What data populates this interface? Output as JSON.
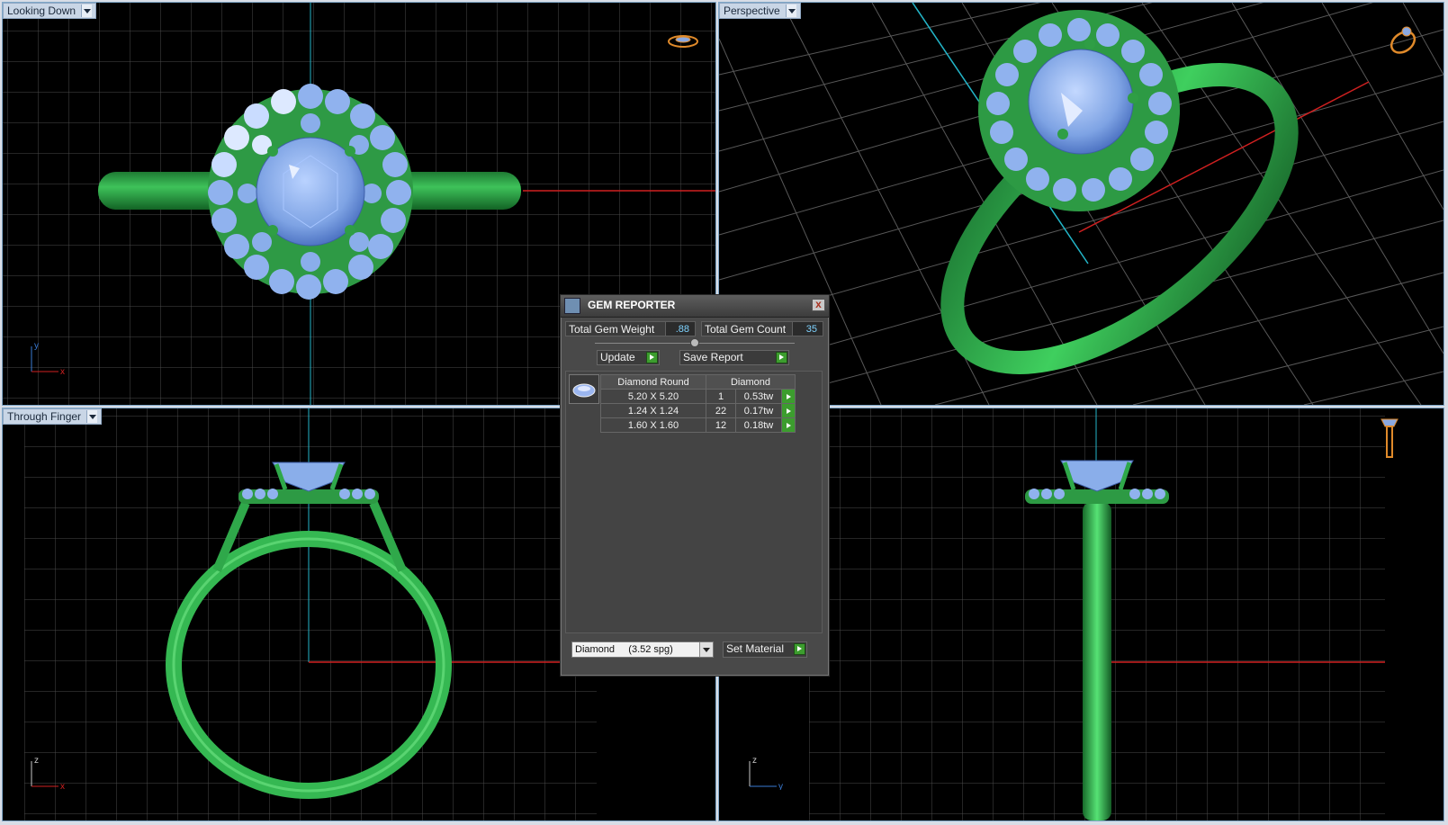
{
  "viewports": {
    "top_left": {
      "label": "Looking Down",
      "axes": [
        "y",
        "x"
      ]
    },
    "top_right": {
      "label": "Perspective"
    },
    "bottom_left": {
      "label": "Through Finger",
      "axes": [
        "z",
        "x"
      ]
    },
    "bottom_right": {
      "axes": [
        "z",
        "y"
      ]
    }
  },
  "gem_reporter": {
    "title": "GEM REPORTER",
    "close_label": "x",
    "total_gem_weight_label": "Total Gem Weight",
    "total_gem_weight_value": ".88",
    "total_gem_count_label": "Total Gem Count",
    "total_gem_count_value": "35",
    "update_label": "Update",
    "save_report_label": "Save Report",
    "table": {
      "headers": [
        "Diamond Round",
        "Diamond"
      ],
      "rows": [
        {
          "size": "5.20 X 5.20",
          "count": "1",
          "weight": "0.53tw"
        },
        {
          "size": "1.24 X 1.24",
          "count": "22",
          "weight": "0.17tw"
        },
        {
          "size": "1.60 X 1.60",
          "count": "12",
          "weight": "0.18tw"
        }
      ]
    },
    "material_select": "Diamond     (3.52 spg)",
    "set_material_label": "Set Material"
  },
  "colors": {
    "metal": "#2fa84a",
    "gem": "#8fb4f0",
    "grid": "#4a4a4a",
    "axis_x": "#d02020",
    "axis_y": "#23b5c8",
    "go_button": "#3c9d2e"
  }
}
